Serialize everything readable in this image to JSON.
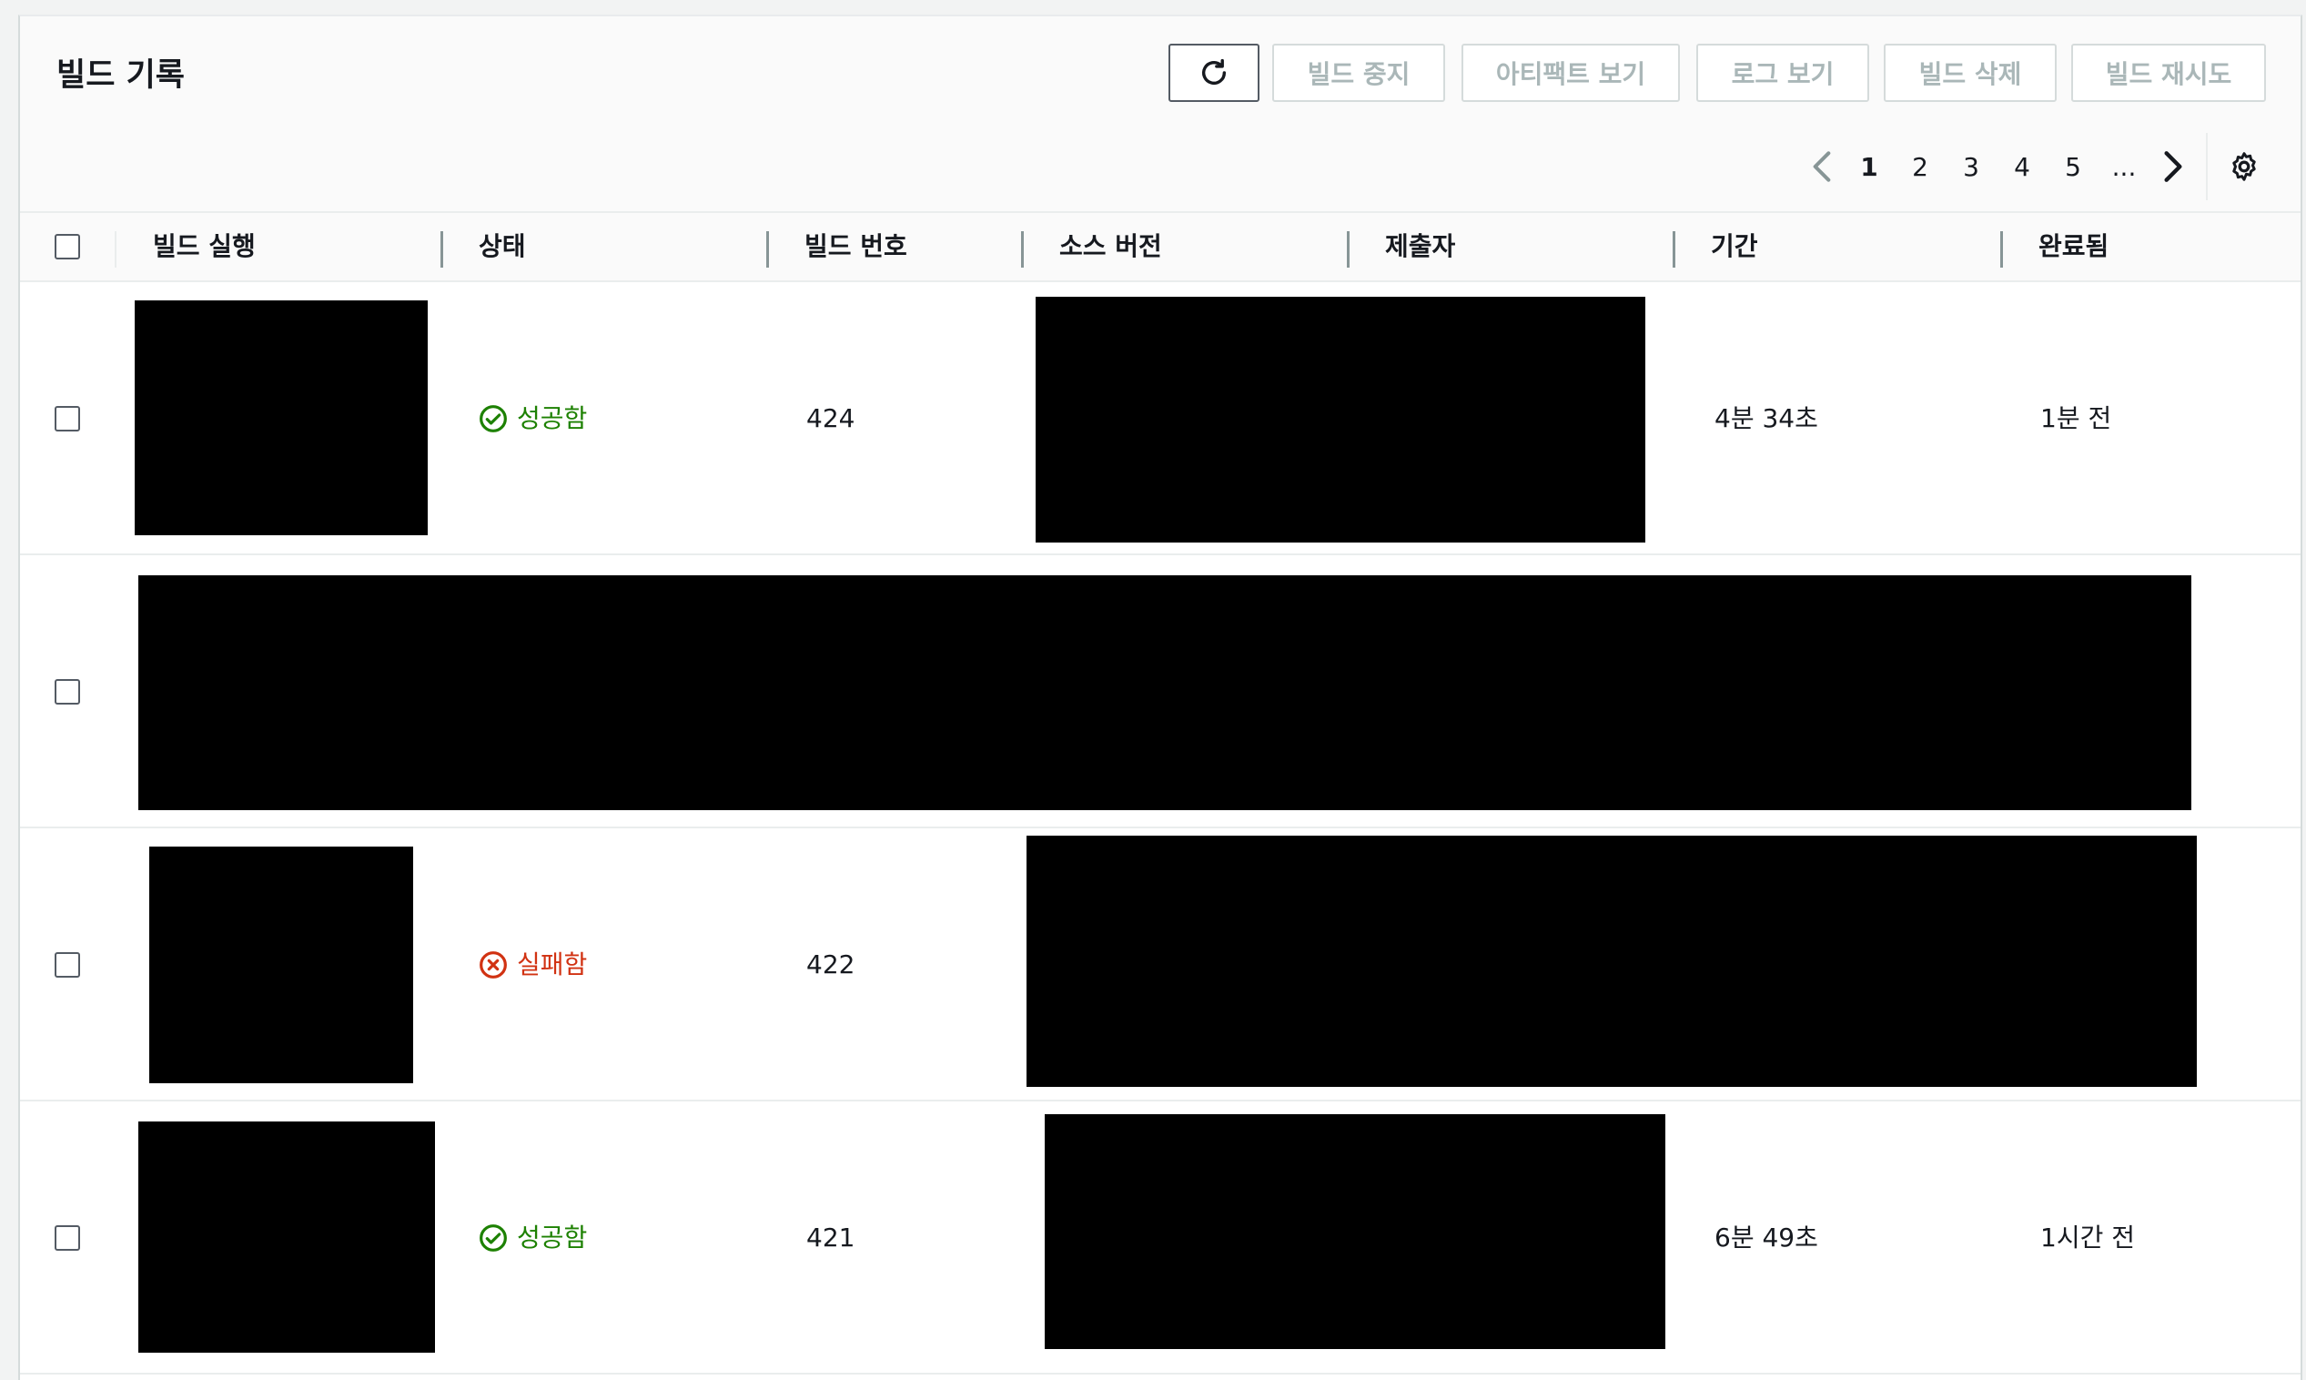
{
  "panel": {
    "title": "빌드 기록",
    "buttons": {
      "stop": "빌드 중지",
      "artifacts": "아티팩트 보기",
      "logs": "로그 보기",
      "delete": "빌드 삭제",
      "retry": "빌드 재시도"
    },
    "icons": {
      "refresh": "refresh-icon",
      "prev": "chevron-left-icon",
      "next": "chevron-right-icon",
      "settings": "gear-icon"
    },
    "pagination": {
      "pages": [
        "1",
        "2",
        "3",
        "4",
        "5"
      ],
      "ellipsis": "...",
      "current": "1"
    }
  },
  "table": {
    "columns": [
      "빌드 실행",
      "상태",
      "빌드 번호",
      "소스 버전",
      "제출자",
      "기간",
      "완료됨"
    ],
    "rows": [
      {
        "status": "성공함",
        "status_type": "success",
        "build_number": "424",
        "duration": "4분 34초",
        "completed": "1분 전"
      },
      {
        "status": "",
        "status_type": "",
        "build_number": "",
        "duration": "",
        "completed": ""
      },
      {
        "status": "실패함",
        "status_type": "failed",
        "build_number": "422",
        "duration": "",
        "completed": ""
      },
      {
        "status": "성공함",
        "status_type": "success",
        "build_number": "421",
        "duration": "6분 49초",
        "completed": "1시간 전"
      }
    ]
  },
  "colors": {
    "success": "#1d8102",
    "failed": "#d13212",
    "disabled_text": "#aab7b8"
  }
}
